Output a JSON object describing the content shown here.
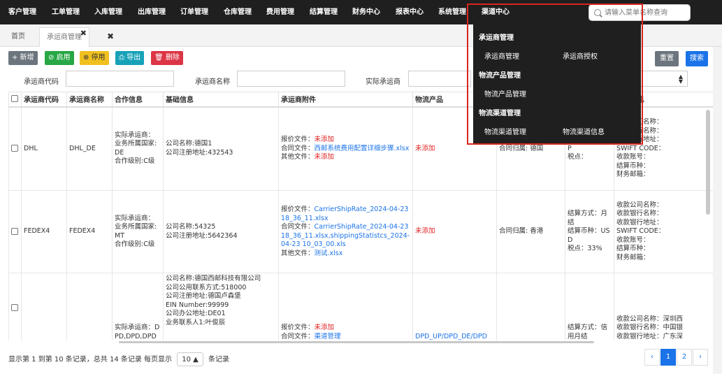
{
  "nav": {
    "items": [
      "客户管理",
      "工单管理",
      "入库管理",
      "出库管理",
      "订单管理",
      "仓库管理",
      "费用管理",
      "结算管理",
      "财务中心",
      "报表中心",
      "系统管理",
      "渠道中心"
    ],
    "search_placeholder": "请输入菜单名称查询"
  },
  "tabs": {
    "home": "首页",
    "active": "承运商管理",
    "close_icon": "✖",
    "close_all_icon": "✖"
  },
  "toolbar": {
    "add": "+ 新增",
    "enable": "⊘ 启用",
    "disable": "⊗ 停用",
    "export": "⎙ 导出",
    "delete": "🗑 删除",
    "reset": "重置",
    "search": "搜索"
  },
  "filters": {
    "carrier_code": "承运商代码",
    "carrier_name": "承运商名称",
    "actual_carrier": "实际承运商"
  },
  "table": {
    "headers": [
      "承运商代码",
      "承运商名称",
      "合作信息",
      "基础信息",
      "承运商附件",
      "物流产品",
      "",
      "",
      "收款信息"
    ],
    "rows": [
      {
        "code": "DHL",
        "name": "DHL_DE",
        "coop": "实际承运商：业务所属国家:DE\n合作级别:C级",
        "basic": "公司名称:德国1\n公司注册地址:432543",
        "att_quote_label": "报价文件：",
        "att_quote": "未添加",
        "att_contract_label": "合同文件：",
        "att_contract": "西邮系统费用配置详细步骤.xlsx",
        "att_other_label": "其他文件：",
        "att_other": "未添加",
        "product": "未添加",
        "region": "合同归属: 德国",
        "settle": "结算币种：GBP\n税点：",
        "pay": "收款公司名称：\n收款银行名称：\n收款银行地址：\nSWIFT CODE：\n收款账号：\n结算币种：\n财务邮箱："
      },
      {
        "code": "FEDEX4",
        "name": "FEDEX4",
        "coop": "实际承运商：业务所属国家:MT\n合作级别:C级",
        "basic": "公司名称:54325\n公司注册地址:5642364",
        "att_quote_label": "报价文件：",
        "att_quote": "CarrierShipRate_2024-04-2318_36_11.xlsx",
        "att_contract_label": "合同文件：",
        "att_contract": "CarrierShipRate_2024-04-2318_36_11.xlsx,shippingStatistcs_2024-04-23 10_03_00.xls",
        "att_other_label": "其他文件：",
        "att_other": "测试.xlsx",
        "product": "未添加",
        "region": "合同归属: 香港",
        "settle": "结算方式：月结\n结算币种：USD\n税点：33%",
        "pay": "收款公司名称：\n收款银行名称：\n收款银行地址：\nSWIFT CODE：\n收款账号：\n结算币种：\n财务邮箱："
      },
      {
        "code": "",
        "name": "",
        "coop": "实际承运商：DPD,DPD,DPD",
        "basic": "公司名称:德国西邮科技有限公司\n公司公用联系方式:518000\n公司注册地址:德国卢森堡\nEIN Number:99999\n公司办公地址:DE01\n业务联系人1:叶俊辰",
        "att_quote_label": "报价文件：",
        "att_quote": "未添加",
        "att_contract_label": "合同文件：",
        "att_contract": "渠道管理",
        "att_other_label": "",
        "att_other": "",
        "product": "DPD_UP/DPD_DE/DPD",
        "region": "",
        "settle": "结算方式：信用月结",
        "pay": "收款公司名称：深圳西\n收款银行名称：中国银\n收款银行地址：广东深"
      }
    ]
  },
  "footer": {
    "info_prefix": "显示第 1 到第 10 条记录，总共 14 条记录  每页显示",
    "page_size": "10 ▲",
    "info_suffix": "条记录",
    "prev": "‹",
    "page1": "1",
    "page2": "2",
    "next": "›"
  },
  "dropdown": {
    "group1_title": "承运商管理",
    "group1_item1": "承运商管理",
    "group1_item2": "承运商授权",
    "group2_title": "物流产品管理",
    "group2_item1": "物流产品管理",
    "group3_title": "物流渠道管理",
    "group3_item1": "物流渠道管理",
    "group3_item2": "物流渠道信息"
  },
  "colors": {
    "nav_bg": "#1f1f1f",
    "primary": "#1a73e8",
    "danger": "#dc3545",
    "success": "#28a745",
    "warning": "#f0c020",
    "info": "#17a2b8",
    "highlight": "#d9251c"
  }
}
